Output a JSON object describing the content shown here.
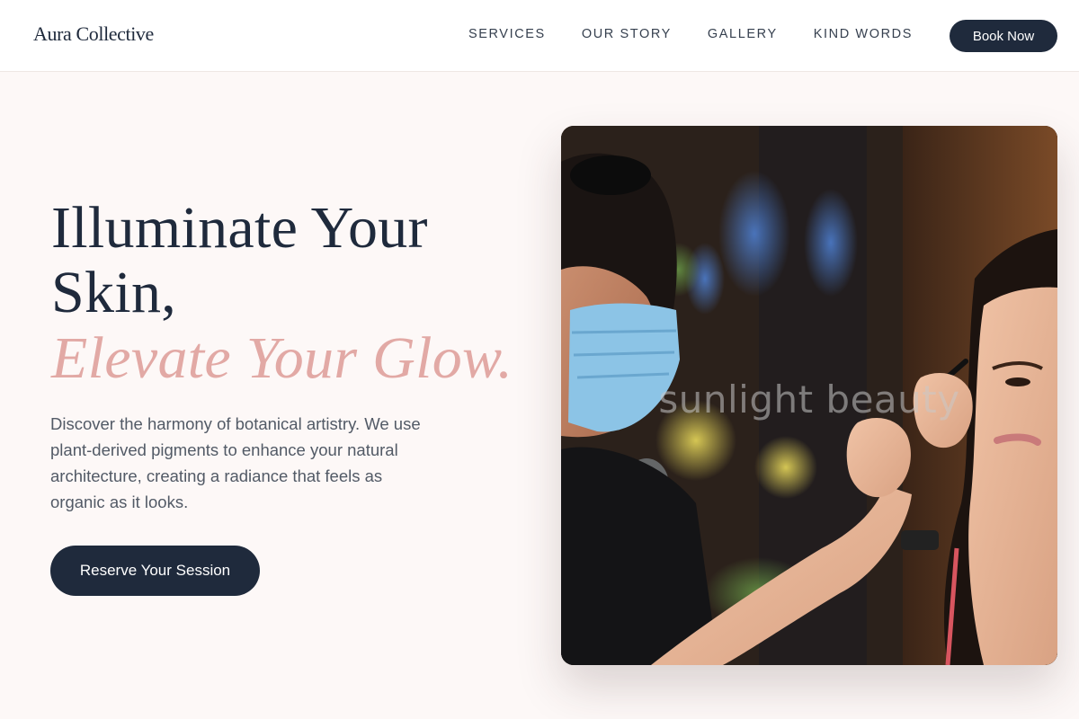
{
  "brand": {
    "name": "Aura Collective"
  },
  "nav": {
    "items": [
      {
        "label": "SERVICES"
      },
      {
        "label": "OUR STORY"
      },
      {
        "label": "GALLERY"
      },
      {
        "label": "KIND WORDS"
      }
    ],
    "cta_label": "Book Now"
  },
  "hero": {
    "title_line1": "Illuminate Your",
    "title_line2": "Skin,",
    "title_accent": "Elevate Your Glow.",
    "description": "Discover the harmony of botanical artistry. We use plant-derived pigments to enhance your natural architecture, creating a radiance that feels as organic as it looks.",
    "cta_label": "Reserve Your Session",
    "image_caption": "sunlight beauty"
  },
  "colors": {
    "navy": "#1f2a3c",
    "accent_pink": "#e2a9a5",
    "background": "#fdf8f7"
  }
}
